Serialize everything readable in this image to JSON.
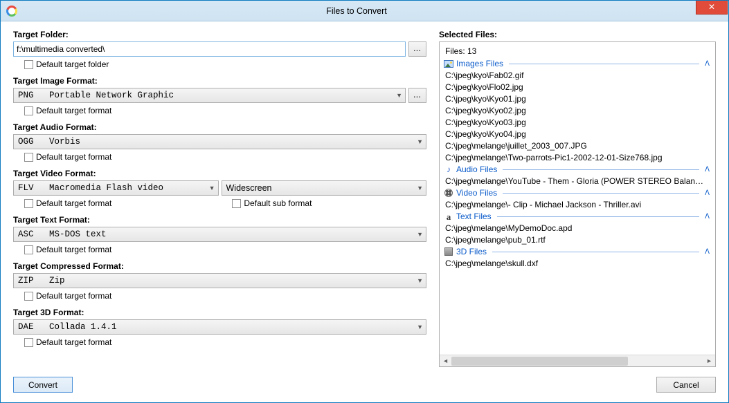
{
  "window": {
    "title": "Files to Convert",
    "close_glyph": "✕"
  },
  "labels": {
    "target_folder": "Target Folder:",
    "target_image": "Target Image Format:",
    "target_audio": "Target Audio Format:",
    "target_video": "Target Video Format:",
    "target_text": "Target Text Format:",
    "target_compressed": "Target Compressed Format:",
    "target_3d": "Target 3D Format:",
    "selected_files": "Selected Files:"
  },
  "folder": {
    "value": "f:\\multimedia converted\\",
    "browse": "...",
    "default_chk": "Default target folder"
  },
  "formats": {
    "image": {
      "value": "PNG   Portable Network Graphic",
      "default_chk": "Default target format",
      "browse": "..."
    },
    "audio": {
      "value": "OGG   Vorbis",
      "default_chk": "Default target format"
    },
    "video": {
      "value": "FLV   Macromedia Flash video",
      "sub_value": "Widescreen",
      "default_chk": "Default target format",
      "default_sub_chk": "Default sub format"
    },
    "text": {
      "value": "ASC   MS-DOS text",
      "default_chk": "Default target format"
    },
    "compressed": {
      "value": "ZIP   Zip",
      "default_chk": "Default target format"
    },
    "three_d": {
      "value": "DAE   Collada 1.4.1",
      "default_chk": "Default target format"
    }
  },
  "files": {
    "count_label": "Files: 13",
    "groups": [
      {
        "name": "Images Files",
        "icon": "img",
        "items": [
          "C:\\jpeg\\kyo\\Fab02.gif",
          "C:\\jpeg\\kyo\\Flo02.jpg",
          "C:\\jpeg\\kyo\\Kyo01.jpg",
          "C:\\jpeg\\kyo\\Kyo02.jpg",
          "C:\\jpeg\\kyo\\Kyo03.jpg",
          "C:\\jpeg\\kyo\\Kyo04.jpg",
          "C:\\jpeg\\melange\\juillet_2003_007.JPG",
          "C:\\jpeg\\melange\\Two-parrots-Pic1-2002-12-01-Size768.jpg"
        ]
      },
      {
        "name": "Audio Files",
        "icon": "audio",
        "items": [
          "C:\\jpeg\\melange\\YouTube - Them - Gloria (POWER STEREO Balanced Re..."
        ]
      },
      {
        "name": "Video Files",
        "icon": "video",
        "items": [
          "C:\\jpeg\\melange\\- Clip - Michael Jackson - Thriller.avi"
        ]
      },
      {
        "name": "Text Files",
        "icon": "text",
        "items": [
          "C:\\jpeg\\melange\\MyDemoDoc.apd",
          "C:\\jpeg\\melange\\pub_01.rtf"
        ]
      },
      {
        "name": "3D Files",
        "icon": "3d",
        "items": [
          "C:\\jpeg\\melange\\skull.dxf"
        ]
      }
    ]
  },
  "buttons": {
    "convert": "Convert",
    "cancel": "Cancel"
  },
  "glyphs": {
    "chev_down": "▼",
    "chev_up": "⌃",
    "arrow_left": "◄",
    "arrow_right": "►",
    "collapse": "ᐱ"
  }
}
